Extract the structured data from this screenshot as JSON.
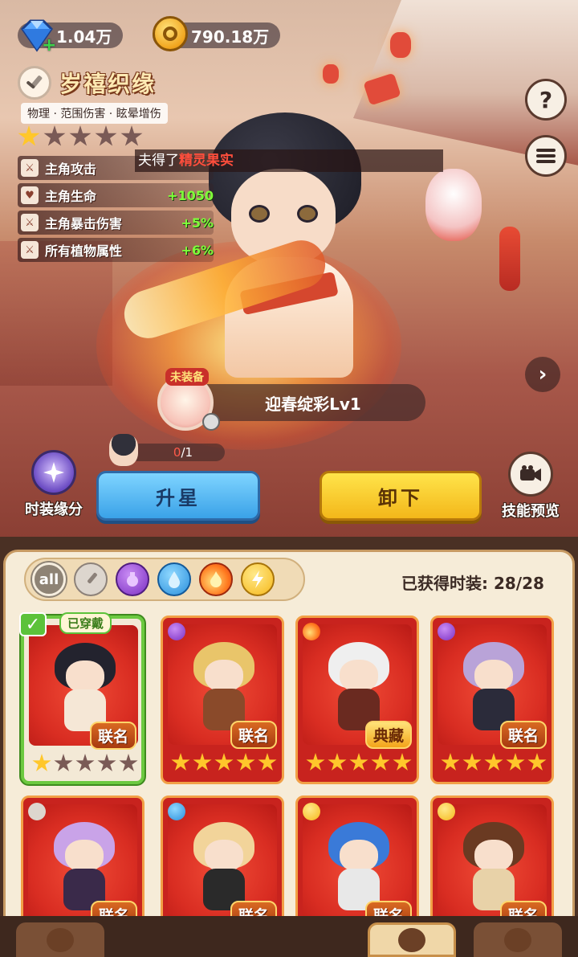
{
  "currency": {
    "gems": "1.04万",
    "coins": "790.18万"
  },
  "costume": {
    "title": "岁禧织缘",
    "tags": "物理 · 范围伤害 · 眩晕增伤",
    "star_level": 1,
    "max_stars": 5
  },
  "stats": [
    {
      "label": "主角攻击",
      "value": "",
      "icon": "sword-icon"
    },
    {
      "label": "主角生命",
      "value": "+1050",
      "icon": "heart-icon"
    },
    {
      "label": "主角暴击伤害",
      "value": "+5%",
      "icon": "crit-sword-icon"
    },
    {
      "label": "所有植物属性",
      "value": "+6%",
      "icon": "plant-sword-icon"
    }
  ],
  "toast": {
    "prefix": "夫得了",
    "item": "精灵果实"
  },
  "skin": {
    "unequipped_tag": "未装备",
    "name": "迎春绽彩Lv1"
  },
  "fragments": {
    "current": "0",
    "total": "/1"
  },
  "buttons": {
    "fate": "时装缘分",
    "upgrade": "升星",
    "unload": "卸下",
    "preview": "技能预览",
    "help": "?"
  },
  "filters": {
    "all": "all",
    "items": [
      "sword-icon",
      "potion-icon",
      "water-drop-icon",
      "fire-icon",
      "lightning-icon"
    ]
  },
  "collection": {
    "label": "已获得时装: 28/28"
  },
  "cards": [
    {
      "tag": "联名",
      "stars": 1,
      "type": "none",
      "equipped": true,
      "equipped_label": "已穿戴",
      "hair": "#23232e",
      "body": "#f5e7d6"
    },
    {
      "tag": "联名",
      "stars": 5,
      "type": "potion-icon",
      "equipped": false,
      "hair": "#e9c56a",
      "body": "#8a4a2a"
    },
    {
      "tag": "典藏",
      "stars": 5,
      "type": "fire-icon",
      "equipped": false,
      "hair": "#efefef",
      "body": "#6a2a20"
    },
    {
      "tag": "联名",
      "stars": 5,
      "type": "potion-icon",
      "equipped": false,
      "hair": "#b9a3d8",
      "body": "#2b2b3a"
    },
    {
      "tag": "联名",
      "stars": 0,
      "type": "sword-icon",
      "equipped": false,
      "hair": "#c9a3e8",
      "body": "#3a2a4a"
    },
    {
      "tag": "联名",
      "stars": 0,
      "type": "water-drop-icon",
      "equipped": false,
      "hair": "#f2d49a",
      "body": "#2a2a2a"
    },
    {
      "tag": "联名",
      "stars": 0,
      "type": "lightning-icon",
      "equipped": false,
      "hair": "#3a7ad8",
      "body": "#e8e8e8"
    },
    {
      "tag": "联名",
      "stars": 0,
      "type": "lightning-icon",
      "equipped": false,
      "hair": "#6a3a22",
      "body": "#e8d2a8"
    }
  ],
  "colors": {
    "accent_blue": "#3aa2e8",
    "accent_yellow": "#f3b71a",
    "card_red": "#c8231e",
    "equipped_green": "#6cc940",
    "stat_green": "#7fff3a"
  }
}
